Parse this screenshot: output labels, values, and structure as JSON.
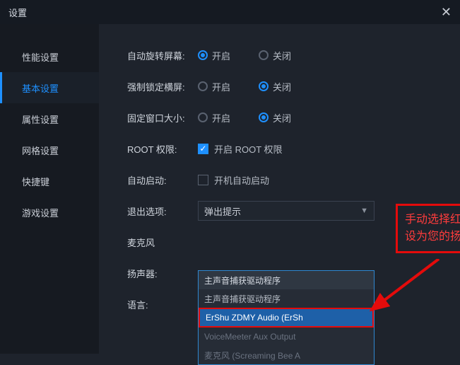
{
  "title": "设置",
  "sidebar": {
    "items": [
      {
        "label": "性能设置"
      },
      {
        "label": "基本设置"
      },
      {
        "label": "属性设置"
      },
      {
        "label": "网格设置"
      },
      {
        "label": "快捷键"
      },
      {
        "label": "游戏设置"
      }
    ]
  },
  "settings": {
    "autoRotate": {
      "label": "自动旋转屏幕:",
      "on": "开启",
      "off": "关闭"
    },
    "forceLand": {
      "label": "强制锁定横屏:",
      "on": "开启",
      "off": "关闭"
    },
    "fixedWin": {
      "label": "固定窗口大小:",
      "on": "开启",
      "off": "关闭"
    },
    "root": {
      "label": "ROOT 权限:",
      "checkbox": "开启 ROOT 权限"
    },
    "autoStart": {
      "label": "自动启动:",
      "checkbox": "开机自动启动"
    },
    "exitOpt": {
      "label": "退出选项:",
      "value": "弹出提示"
    },
    "mic": {
      "label": "麦克风"
    },
    "speaker": {
      "label": "扬声器:"
    },
    "lang": {
      "label": "语言:"
    }
  },
  "dropdown": {
    "options": [
      "主声音捕获驱动程序",
      "主声音捕获驱动程序",
      "ErShu ZDMY Audio (ErSh",
      "VoiceMeeter Aux Output",
      "麦克风 (Screaming Bee A"
    ]
  },
  "callout": {
    "line1": "手动选择红框选项,",
    "line2": "设为您的扬声器设备"
  }
}
